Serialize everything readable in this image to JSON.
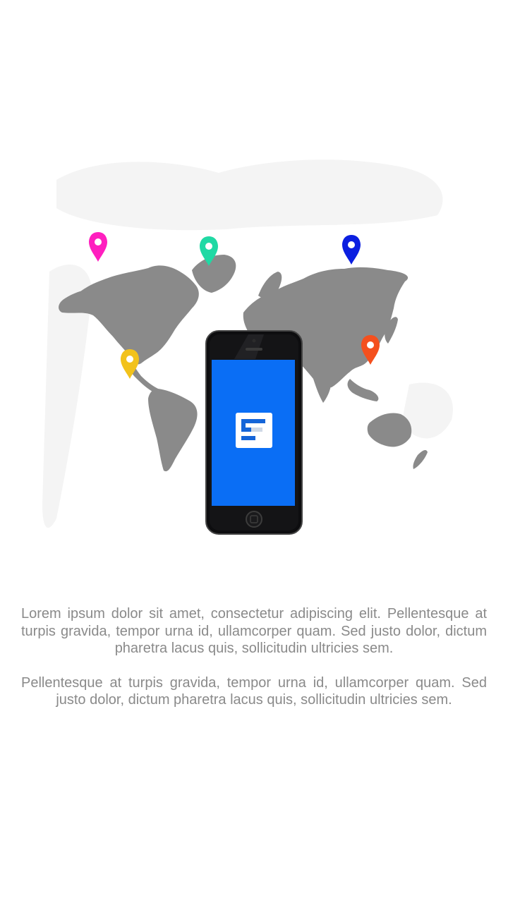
{
  "colors": {
    "background": "#ffffff",
    "map_land": "#8a8a8a",
    "map_ghost": "#f3f3f3",
    "body_text": "#8a8a8a",
    "phone_body": "#0d0d0f",
    "phone_screen": "#0a6ef5",
    "app_logo_bg": "#ffffff",
    "app_logo_mark": "#1565d8"
  },
  "hero": {
    "image": "world-map-with-phone",
    "pins": [
      {
        "name": "pin-alaska",
        "color": "#ff1fbf",
        "icon": "map-pin-icon"
      },
      {
        "name": "pin-greenland",
        "color": "#20d9a4",
        "icon": "map-pin-icon"
      },
      {
        "name": "pin-russia",
        "color": "#0b1fe0",
        "icon": "map-pin-icon"
      },
      {
        "name": "pin-mexico",
        "color": "#f2c21b",
        "icon": "map-pin-icon"
      },
      {
        "name": "pin-east-asia",
        "color": "#f4501e",
        "icon": "map-pin-icon"
      }
    ],
    "phone": {
      "app_icon": "app-logo-icon"
    }
  },
  "intro": {
    "paragraph_1": "Lorem ipsum dolor sit amet, consectetur adipiscing elit. Pellentesque at turpis gravida, tempor urna id, ullamcorper quam. Sed justo dolor, dictum pharetra lacus quis, sollicitudin ultricies sem.",
    "paragraph_2": "Pellentesque at turpis gravida, tempor urna id, ullamcorper quam. Sed justo dolor, dictum pharetra lacus quis, sollicitudin ultricies sem."
  }
}
